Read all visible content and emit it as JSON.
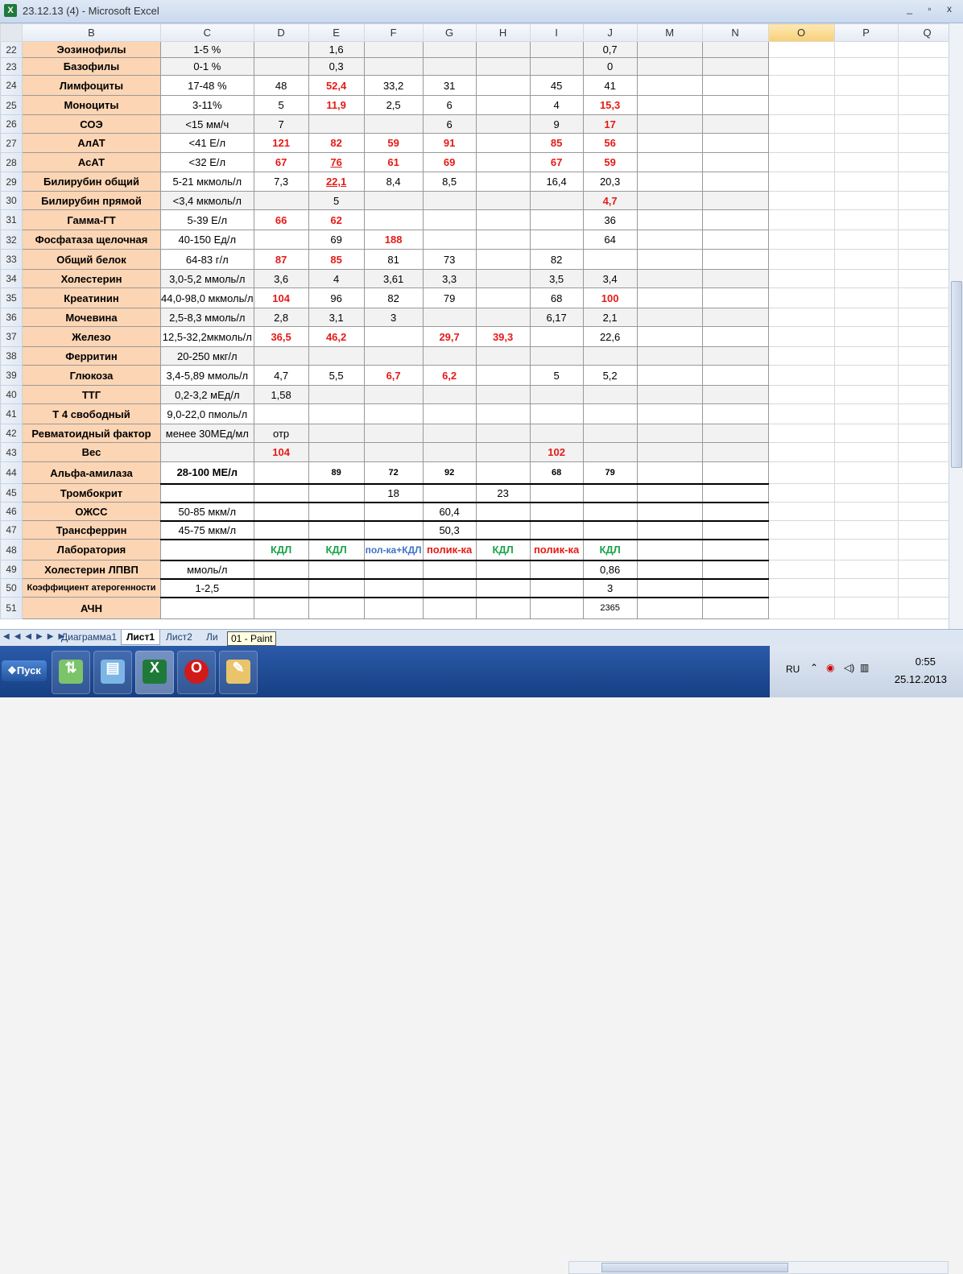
{
  "window": {
    "title": "23.12.13 (4) - Microsoft Excel",
    "controls": "_ ▫ x"
  },
  "columns": [
    "B",
    "C",
    "D",
    "E",
    "F",
    "G",
    "H",
    "I",
    "J",
    "M",
    "N",
    "O",
    "P",
    "Q"
  ],
  "rows": [
    {
      "n": "22",
      "label": "Эозинофилы",
      "ref": "1-5 %",
      "vals": [
        "",
        "1,6",
        "",
        "",
        "",
        "",
        "0,7"
      ]
    },
    {
      "n": "23",
      "label": "Базофилы",
      "ref": "0-1 %",
      "vals": [
        "",
        "0,3",
        "",
        "",
        "",
        "",
        "0"
      ]
    },
    {
      "n": "24",
      "label": "Лимфоциты",
      "ref": "17-48 %",
      "vals": [
        "48",
        "52,4",
        "33,2",
        "31",
        "",
        "45",
        "41"
      ]
    },
    {
      "n": "25",
      "label": "Моноциты",
      "ref": "3-11%",
      "vals": [
        "5",
        "11,9",
        "2,5",
        "6",
        "",
        "4",
        "15,3"
      ]
    },
    {
      "n": "26",
      "label": "СОЭ",
      "ref": "<15 мм/ч",
      "vals": [
        "7",
        "",
        "",
        "6",
        "",
        "9",
        "17"
      ]
    },
    {
      "n": "27",
      "label": "АлАТ",
      "ref": "<41 Е/л",
      "vals": [
        "121",
        "82",
        "59",
        "91",
        "",
        "85",
        "56"
      ]
    },
    {
      "n": "28",
      "label": "АсАТ",
      "ref": "<32 Е/л",
      "vals": [
        "67",
        "76",
        "61",
        "69",
        "",
        "67",
        "59"
      ]
    },
    {
      "n": "29",
      "label": "Билирубин общий",
      "ref": "5-21 мкмоль/л",
      "vals": [
        "7,3",
        "22,1",
        "8,4",
        "8,5",
        "",
        "16,4",
        "20,3"
      ]
    },
    {
      "n": "30",
      "label": "Билирубин прямой",
      "ref": "<3,4 мкмоль/л",
      "vals": [
        "",
        "5",
        "",
        "",
        "",
        "",
        "4,7"
      ]
    },
    {
      "n": "31",
      "label": "Гамма-ГТ",
      "ref": "5-39 Е/л",
      "vals": [
        "66",
        "62",
        "",
        "",
        "",
        "",
        "36"
      ]
    },
    {
      "n": "32",
      "label": "Фосфатаза щелочная",
      "ref": "40-150 Ед/л",
      "vals": [
        "",
        "69",
        "188",
        "",
        "",
        "",
        "64"
      ]
    },
    {
      "n": "33",
      "label": "Общий белок",
      "ref": "64-83 г/л",
      "vals": [
        "87",
        "85",
        "81",
        "73",
        "",
        "82",
        ""
      ]
    },
    {
      "n": "34",
      "label": "Холестерин",
      "ref": "3,0-5,2 ммоль/л",
      "vals": [
        "3,6",
        "4",
        "3,61",
        "3,3",
        "",
        "3,5",
        "3,4"
      ]
    },
    {
      "n": "35",
      "label": "Креатинин",
      "ref": "44,0-98,0 мкмоль/л",
      "vals": [
        "104",
        "96",
        "82",
        "79",
        "",
        "68",
        "100"
      ]
    },
    {
      "n": "36",
      "label": "Мочевина",
      "ref": "2,5-8,3 ммоль/л",
      "vals": [
        "2,8",
        "3,1",
        "3",
        "",
        "",
        "6,17",
        "2,1"
      ]
    },
    {
      "n": "37",
      "label": "Железо",
      "ref": "12,5-32,2мкмоль/л",
      "vals": [
        "36,5",
        "46,2",
        "",
        "29,7",
        "39,3",
        "",
        "22,6"
      ]
    },
    {
      "n": "38",
      "label": "Ферритин",
      "ref": "20-250 мкг/л",
      "vals": [
        "",
        "",
        "",
        "",
        "",
        "",
        ""
      ]
    },
    {
      "n": "39",
      "label": "Глюкоза",
      "ref": "3,4-5,89 ммоль/л",
      "vals": [
        "4,7",
        "5,5",
        "6,7",
        "6,2",
        "",
        "5",
        "5,2"
      ]
    },
    {
      "n": "40",
      "label": "ТТГ",
      "ref": "0,2-3,2 мЕд/л",
      "vals": [
        "1,58",
        "",
        "",
        "",
        "",
        "",
        ""
      ]
    },
    {
      "n": "41",
      "label": "Т 4 свободный",
      "ref": "9,0-22,0 пмоль/л",
      "vals": [
        "",
        "",
        "",
        "",
        "",
        "",
        ""
      ]
    },
    {
      "n": "42",
      "label": "Ревматоидный фактор",
      "ref": "менее 30МЕд/мл",
      "vals": [
        "отр",
        "",
        "",
        "",
        "",
        "",
        ""
      ]
    },
    {
      "n": "43",
      "label": "Вес",
      "ref": "",
      "vals": [
        "104",
        "",
        "",
        "",
        "",
        "102",
        ""
      ]
    },
    {
      "n": "44",
      "label": "Альфа-амилаза",
      "ref": "28-100 МЕ/л",
      "vals": [
        "",
        "89",
        "72",
        "92",
        "",
        "68",
        "79"
      ]
    },
    {
      "n": "45",
      "label": "Тромбокрит",
      "ref": "",
      "vals": [
        "",
        "",
        "18",
        "",
        "23",
        "",
        ""
      ]
    },
    {
      "n": "46",
      "label": "ОЖСС",
      "ref": "50-85 мкм/л",
      "vals": [
        "",
        "",
        "",
        "60,4",
        "",
        "",
        ""
      ]
    },
    {
      "n": "47",
      "label": "Трансферрин",
      "ref": "45-75 мкм/л",
      "vals": [
        "",
        "",
        "",
        "50,3",
        "",
        "",
        ""
      ]
    },
    {
      "n": "48",
      "label": "Лаборатория",
      "ref": "",
      "vals": [
        "КДЛ",
        "КДЛ",
        "пол-ка+КДЛ",
        "полик-ка",
        "КДЛ",
        "полик-ка",
        "КДЛ"
      ]
    },
    {
      "n": "49",
      "label": "Холестерин ЛПВП",
      "ref": "ммоль/л",
      "vals": [
        "",
        "",
        "",
        "",
        "",
        "",
        "0,86"
      ]
    },
    {
      "n": "50",
      "label": "Коэффициент атерогенности",
      "ref": "1-2,5",
      "vals": [
        "",
        "",
        "",
        "",
        "",
        "",
        "3"
      ]
    },
    {
      "n": "51",
      "label": "АЧН",
      "ref": "",
      "vals": [
        "",
        "",
        "",
        "",
        "",
        "",
        "2365"
      ]
    }
  ],
  "sheet_tabs": [
    "Диаграмма1",
    "Лист1",
    "Лист2",
    "Ли"
  ],
  "active_sheet": "Лист1",
  "tooltip": "01 - Paint",
  "taskbar": {
    "start_label": "Пуск",
    "language": "RU",
    "time": "0:55",
    "date": "25.12.2013"
  },
  "colors": {
    "label_bg": "#fcd5b4",
    "abnormal": "#e41b17",
    "kdl": "#1aa34a",
    "polyclinic_kdl": "#3e74c9"
  }
}
